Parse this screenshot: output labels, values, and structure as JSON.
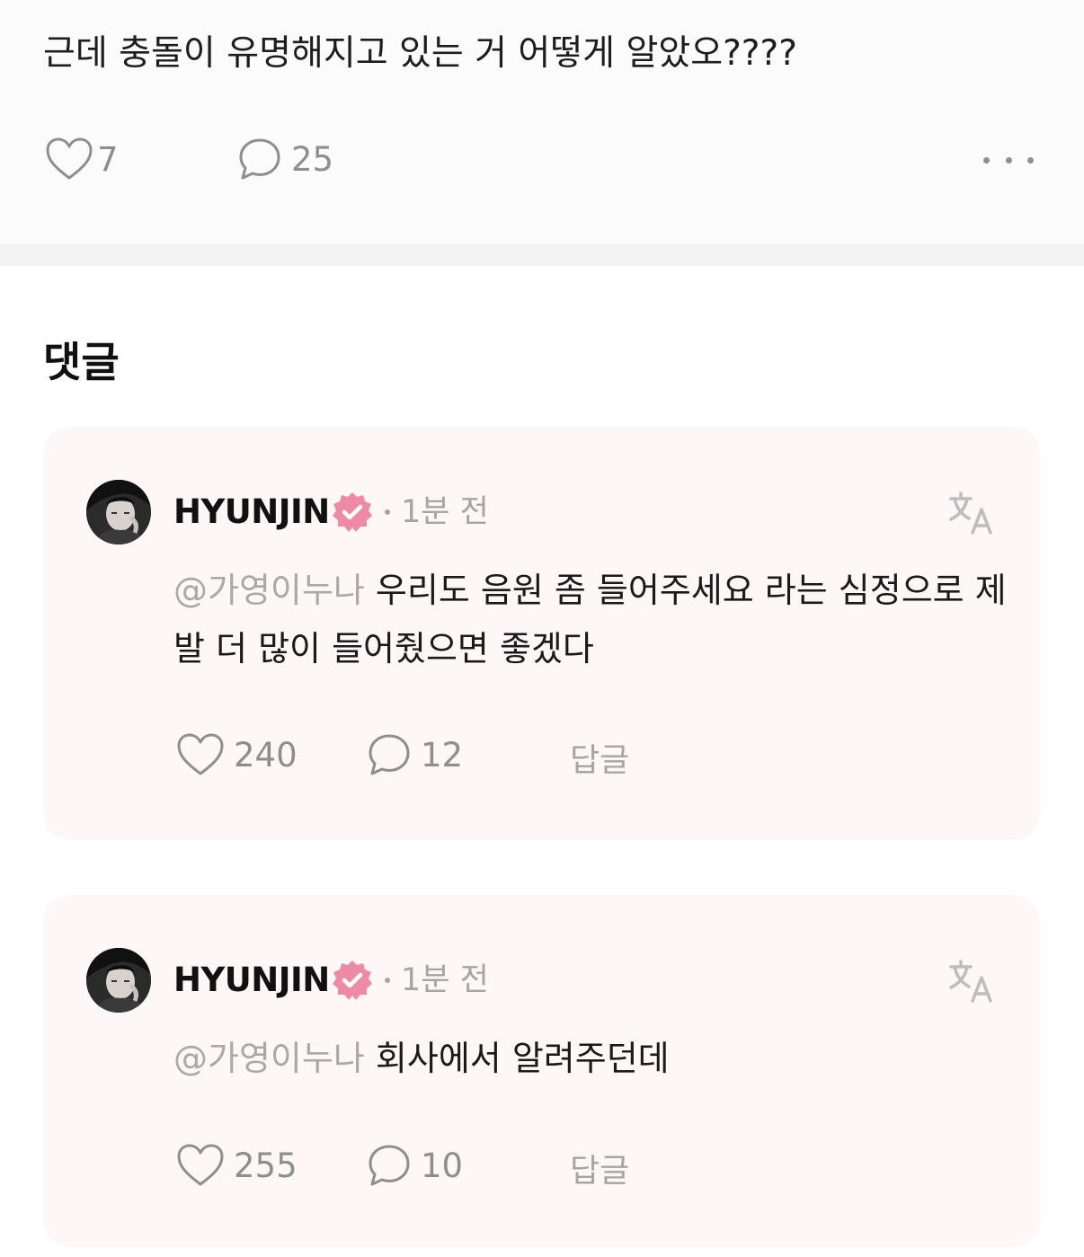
{
  "post": {
    "text": "근데 충돌이 유명해지고 있는 거 어떻게 알았오????",
    "like_count": "7",
    "comment_count": "25"
  },
  "comments_section": {
    "title": "댓글"
  },
  "comments": [
    {
      "author": "HYUNJIN",
      "time": "1분 전",
      "mention": "@가영이누나",
      "text": "우리도 음원 좀 들어주세요 라는 심정으로 제발 더 많이 들어줬으면 좋겠다",
      "like_count": "240",
      "reply_count": "12",
      "reply_label": "답글"
    },
    {
      "author": "HYUNJIN",
      "time": "1분 전",
      "mention": "@가영이누나",
      "text": "회사에서 알려주던데",
      "like_count": "255",
      "reply_count": "10",
      "reply_label": "답글"
    }
  ],
  "colors": {
    "badge": "#ef8aa6",
    "card_background": "#fdf7f8",
    "muted": "#8e8e8e"
  },
  "icons": [
    "heart-icon",
    "comment-bubble-icon",
    "more-icon",
    "verified-badge-icon",
    "translate-icon"
  ]
}
